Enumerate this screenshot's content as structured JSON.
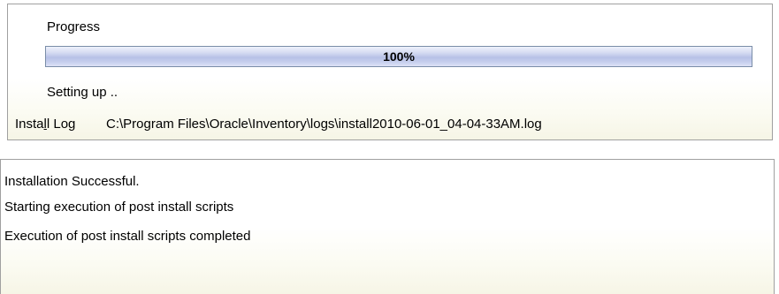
{
  "progress": {
    "title": "Progress",
    "percent_label": "100%",
    "percent_value": 100,
    "status": "Setting up ..",
    "colors": {
      "fill": "#b7c1e6",
      "border": "#7a8da8"
    }
  },
  "install_log": {
    "label_prefix": "Insta",
    "label_mnemonic": "l",
    "label_suffix": "l Log",
    "path": "C:\\Program Files\\Oracle\\Inventory\\logs\\install2010-06-01_04-04-33AM.log"
  },
  "output": {
    "lines": [
      "Installation Successful.",
      "Starting execution of post install scripts",
      "Execution of post install scripts completed"
    ]
  }
}
